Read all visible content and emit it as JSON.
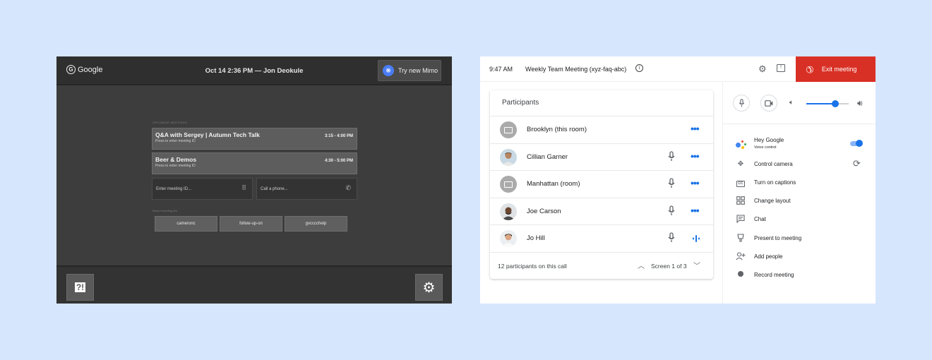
{
  "old_ui": {
    "logo_text": "Google",
    "header_title": "Oct 14 2:36 PM — Jon Deokule",
    "mimo_label": "Try new Mimo",
    "upcoming_label": "UPCOMING MEETINGS",
    "meetings": [
      {
        "title": "Q&A with Sergey | Autumn Tech Talk",
        "subtitle": "Press to enter meeting ID",
        "time": "3:15 - 4:00 PM"
      },
      {
        "title": "Beer & Demos",
        "subtitle": "Press to enter meeting ID",
        "time": "4:30 - 5:00 PM"
      }
    ],
    "meeting_id_placeholder": "Enter meeting ID...",
    "phone_placeholder": "Call a phone...",
    "recent_label": "Recent meeting IDs",
    "recent_chips": [
      "cameronc",
      "follow-up-on",
      "gvcccchelp"
    ]
  },
  "new_ui": {
    "time": "9:47 AM",
    "meeting_title": "Weekly Team Meeting  (xyz-faq-abc)",
    "exit_label": "Exit meeting",
    "participants_title": "Participants",
    "participants": [
      {
        "name": "Brooklyn (this room)",
        "avatar": "room",
        "mic": false,
        "action": "more"
      },
      {
        "name": "Cillian Garner",
        "avatar": "person",
        "mic": true,
        "action": "more"
      },
      {
        "name": "Manhattan (room)",
        "avatar": "room",
        "mic": true,
        "action": "more"
      },
      {
        "name": "Joe Carson",
        "avatar": "person",
        "mic": true,
        "action": "more"
      },
      {
        "name": "Jo Hill",
        "avatar": "person",
        "mic": true,
        "action": "speaking"
      }
    ],
    "participants_count": "12 participants on this call",
    "screen_indicator": "Screen 1 of 3",
    "volume_level": 0.68,
    "menu": [
      {
        "label": "Hey Google",
        "sublabel": "Voice control",
        "icon": "google-assistant-icon",
        "trailing": "toggle-on"
      },
      {
        "label": "Control camera",
        "icon": "camera-control-icon",
        "trailing": "refresh"
      },
      {
        "label": "Turn on captions",
        "icon": "captions-icon"
      },
      {
        "label": "Change layout",
        "icon": "layout-icon"
      },
      {
        "label": "Chat",
        "icon": "chat-icon"
      },
      {
        "label": "Present to meeting",
        "icon": "present-icon"
      },
      {
        "label": "Add people",
        "icon": "add-person-icon"
      },
      {
        "label": "Record meeting",
        "icon": "record-icon"
      }
    ],
    "accent_color": "#1a73e8",
    "exit_color": "#d93025"
  }
}
